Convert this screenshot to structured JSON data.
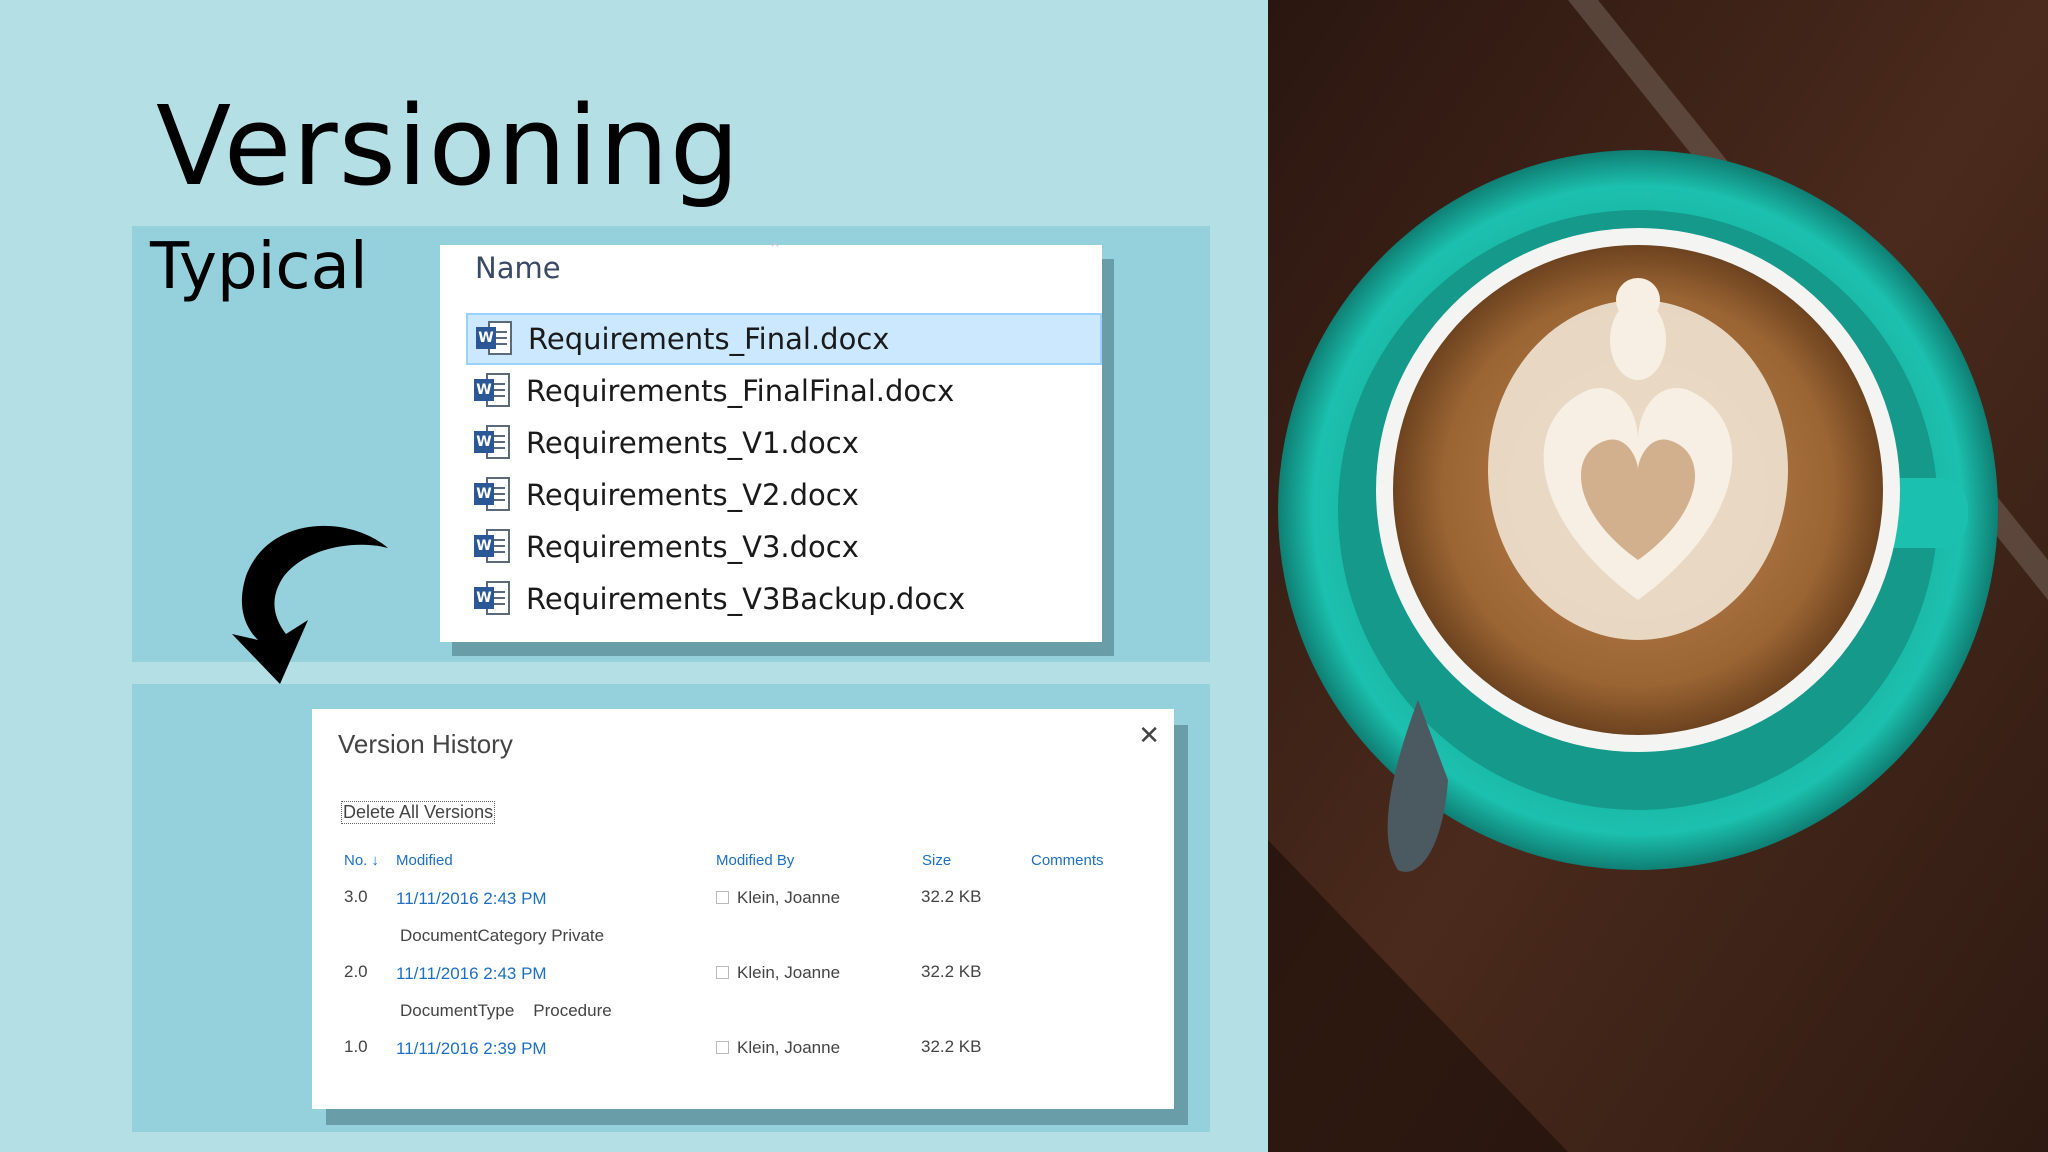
{
  "slide": {
    "title": "Versioning",
    "subtitle": "Typical"
  },
  "explorer": {
    "column_header": "Name",
    "files": [
      {
        "name": "Requirements_Final.docx",
        "selected": true
      },
      {
        "name": "Requirements_FinalFinal.docx",
        "selected": false
      },
      {
        "name": "Requirements_V1.docx",
        "selected": false
      },
      {
        "name": "Requirements_V2.docx",
        "selected": false
      },
      {
        "name": "Requirements_V3.docx",
        "selected": false
      },
      {
        "name": "Requirements_V3Backup.docx",
        "selected": false
      }
    ],
    "icon": "word-document-icon",
    "icon_badge": "W"
  },
  "version_history": {
    "title": "Version History",
    "close_glyph": "✕",
    "delete_all_label": "Delete All Versions",
    "columns": {
      "no": "No.",
      "sort_glyph": "↓",
      "modified": "Modified",
      "modified_by": "Modified By",
      "size": "Size",
      "comments": "Comments"
    },
    "rows": [
      {
        "no": "3.0",
        "modified": "11/11/2016 2:43 PM",
        "modified_by": "Klein, Joanne",
        "size": "32.2 KB",
        "change_field": "DocumentCategory",
        "change_value": "Private"
      },
      {
        "no": "2.0",
        "modified": "11/11/2016 2:43 PM",
        "modified_by": "Klein, Joanne",
        "size": "32.2 KB",
        "change_field": "DocumentType",
        "change_value": "Procedure"
      },
      {
        "no": "1.0",
        "modified": "11/11/2016 2:39 PM",
        "modified_by": "Klein, Joanne",
        "size": "32.2 KB"
      }
    ]
  },
  "colors": {
    "slide_background": "#b3dfe5",
    "band": "#94d1dc",
    "link_blue": "#1c6fc2",
    "selection": "#cce8ff",
    "cup_teal": "#1fb8a8"
  }
}
